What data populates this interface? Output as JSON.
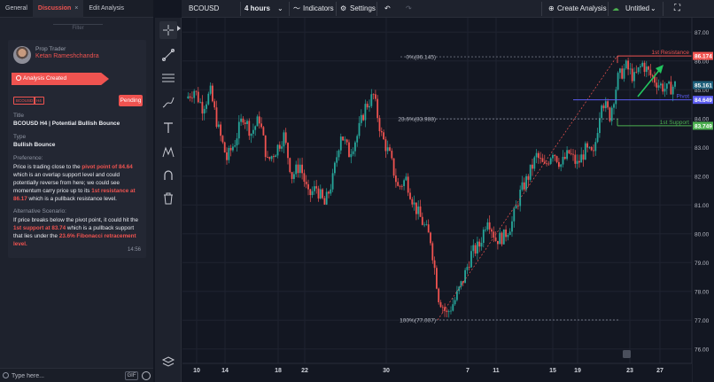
{
  "tabs": [
    {
      "label": "General"
    },
    {
      "label": "Discussion",
      "close": "×"
    },
    {
      "label": "Edit Analysis"
    }
  ],
  "filter_label": "Filter",
  "post": {
    "author_role": "Prop Trader",
    "author_name": "Ketan Rameshchandra",
    "status": "Analysis Created",
    "tags": [
      "BCOUSD",
      "H4"
    ],
    "state_button": "Pending",
    "title_label": "Title",
    "title": "BCOUSD H4 | Potential Bullish Bounce",
    "type_label": "Type",
    "type": "Bullish Bounce",
    "preference_label": "Preference:",
    "preference": [
      {
        "t": "Price is trading close to the ",
        "h": false
      },
      {
        "t": "pivot point of 84.64",
        "h": true
      },
      {
        "t": " which is an overlap support level and could potentially reverse from here; we could see momentum carry price up to its ",
        "h": false
      },
      {
        "t": "1st resistance at 86.17",
        "h": true
      },
      {
        "t": " which is a pullback resistance level.",
        "h": false
      }
    ],
    "alternative_label": "Alternative Scenario:",
    "alternative": [
      {
        "t": "If price breaks below the pivot point, it could hit the ",
        "h": false
      },
      {
        "t": "1st support at 83.74",
        "h": true
      },
      {
        "t": " which is a pullback support that lies under the ",
        "h": false
      },
      {
        "t": "23.6% Fibonacci retracement level.",
        "h": true
      }
    ],
    "time": "14:56"
  },
  "chat": {
    "placeholder": "Type here...",
    "gif": "GIF"
  },
  "topbar": {
    "symbol": "BCOUSD",
    "interval": "4 hours",
    "indicators": "Indicators",
    "settings": "Settings",
    "create_analysis": "Create Analysis",
    "layout_name": "Untitled"
  },
  "colors": {
    "up": "#26a69a",
    "down": "#ef5350",
    "pivot": "#5b5cf0",
    "support": "#4caf50",
    "resistance": "#ef5350",
    "arrow": "#22c55e"
  },
  "chart_data": {
    "type": "candlestick",
    "symbol": "BCOUSD",
    "y_axis": {
      "min": 75.5,
      "max": 87.5,
      "ticks": [
        76.0,
        77.0,
        78.0,
        79.0,
        80.0,
        81.0,
        82.0,
        83.0,
        84.0,
        85.0,
        86.0,
        87.0
      ]
    },
    "x_ticks": [
      "10",
      "14",
      "18",
      "22",
      "30",
      "7",
      "11",
      "15",
      "19",
      "23",
      "27"
    ],
    "fib_levels": [
      {
        "label": "0%(86.145)",
        "value": 86.145
      },
      {
        "label": "23.6%(83.988)",
        "value": 83.988
      },
      {
        "label": "100%(77.007)",
        "value": 77.007
      }
    ],
    "levels": [
      {
        "name": "1st Resistance",
        "value": 86.174,
        "tag": "86.174",
        "role": "resistance"
      },
      {
        "name": "Pivot",
        "value": 84.649,
        "tag": "84.649",
        "role": "pivot"
      },
      {
        "name": "1st Support",
        "value": 83.749,
        "tag": "83.749",
        "role": "support"
      }
    ],
    "last_price": {
      "value": 85.161,
      "tag": "85.161"
    },
    "close_path": [
      [
        0,
        84.7
      ],
      [
        4,
        85.0
      ],
      [
        8,
        84.4
      ],
      [
        12,
        84.9
      ],
      [
        16,
        83.6
      ],
      [
        20,
        82.6
      ],
      [
        24,
        83.2
      ],
      [
        28,
        84.1
      ],
      [
        32,
        83.5
      ],
      [
        36,
        84.0
      ],
      [
        40,
        82.5
      ],
      [
        44,
        82.9
      ],
      [
        48,
        83.4
      ],
      [
        52,
        82.0
      ],
      [
        56,
        82.4
      ],
      [
        60,
        81.3
      ],
      [
        64,
        81.6
      ],
      [
        68,
        81.0
      ],
      [
        72,
        81.9
      ],
      [
        76,
        83.5
      ],
      [
        80,
        82.8
      ],
      [
        84,
        83.4
      ],
      [
        88,
        84.4
      ],
      [
        92,
        84.8
      ],
      [
        96,
        83.4
      ],
      [
        100,
        82.7
      ],
      [
        104,
        81.6
      ],
      [
        108,
        81.9
      ],
      [
        112,
        81.0
      ],
      [
        116,
        80.4
      ],
      [
        120,
        79.8
      ],
      [
        124,
        77.8
      ],
      [
        128,
        77.2
      ],
      [
        132,
        77.7
      ],
      [
        136,
        78.4
      ],
      [
        140,
        79.3
      ],
      [
        144,
        79.6
      ],
      [
        148,
        80.6
      ],
      [
        152,
        79.8
      ],
      [
        156,
        79.9
      ],
      [
        160,
        80.4
      ],
      [
        164,
        81.4
      ],
      [
        168,
        82.0
      ],
      [
        172,
        82.7
      ],
      [
        176,
        82.3
      ],
      [
        180,
        82.9
      ],
      [
        184,
        82.4
      ],
      [
        188,
        82.8
      ],
      [
        192,
        82.4
      ],
      [
        196,
        82.9
      ],
      [
        200,
        82.7
      ],
      [
        204,
        84.7
      ],
      [
        208,
        84.1
      ],
      [
        212,
        85.4
      ],
      [
        216,
        85.8
      ],
      [
        220,
        85.4
      ],
      [
        224,
        85.9
      ],
      [
        228,
        85.5
      ],
      [
        232,
        85.2
      ],
      [
        236,
        85.0
      ],
      [
        240,
        85.16
      ]
    ]
  }
}
